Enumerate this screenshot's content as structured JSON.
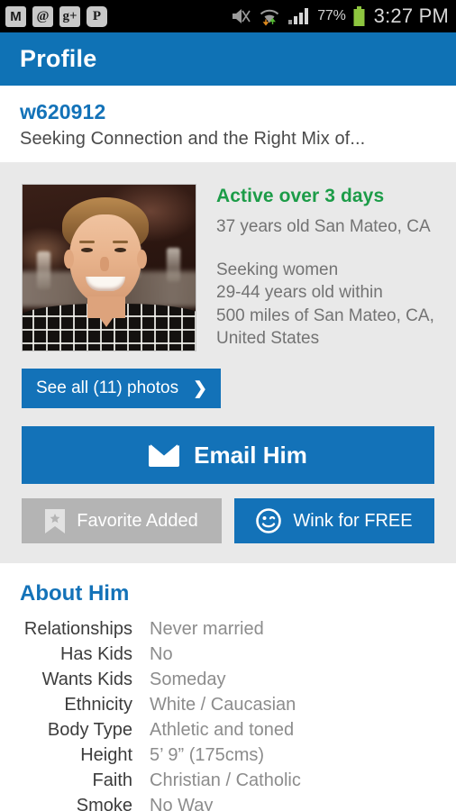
{
  "statusbar": {
    "notifications": [
      {
        "name": "gmail-icon",
        "glyph": "M"
      },
      {
        "name": "email-at-icon",
        "glyph": "@"
      },
      {
        "name": "google-plus-icon",
        "glyph": "g+"
      },
      {
        "name": "pinterest-icon",
        "glyph": "P"
      }
    ],
    "mute_icon": "mute-icon",
    "wifi_icon": "wifi-icon",
    "signal_icon": "signal-bars-icon",
    "battery_percent": "77%",
    "battery_icon": "battery-icon",
    "time": "3:27 PM"
  },
  "header": {
    "title": "Profile"
  },
  "profile": {
    "username": "w620912",
    "tagline": "Seeking Connection and the Right Mix of...",
    "photo_alt": "profile-photo",
    "activity_status": "Active over 3 days",
    "age_location": "37 years old San Mateo, CA",
    "seeking": [
      "Seeking women",
      "29-44 years old within",
      "500 miles of San Mateo, CA,",
      "United States"
    ],
    "photos_button": "See all (11) photos",
    "photos_chevron": "❯"
  },
  "actions": {
    "email_label": "Email Him",
    "email_icon": "envelope-icon",
    "favorite_label": "Favorite Added",
    "favorite_icon": "bookmark-star-icon",
    "wink_label": "Wink for FREE",
    "wink_icon": "winking-face-icon"
  },
  "about": {
    "title": "About Him",
    "rows": [
      {
        "label": "Relationships",
        "value": "Never married"
      },
      {
        "label": "Has Kids",
        "value": "No"
      },
      {
        "label": "Wants Kids",
        "value": "Someday"
      },
      {
        "label": "Ethnicity",
        "value": "White / Caucasian"
      },
      {
        "label": "Body Type",
        "value": "Athletic and toned"
      },
      {
        "label": "Height",
        "value": "5’ 9” (175cms)"
      },
      {
        "label": "Faith",
        "value": "Christian / Catholic"
      },
      {
        "label": "Smoke",
        "value": "No Way"
      }
    ]
  },
  "colors": {
    "brand_blue": "#1372b8",
    "header_blue": "#0f72b5",
    "active_green": "#1c9c48",
    "gray_section": "#e9e9e9",
    "disabled_gray": "#b4b4b4"
  }
}
